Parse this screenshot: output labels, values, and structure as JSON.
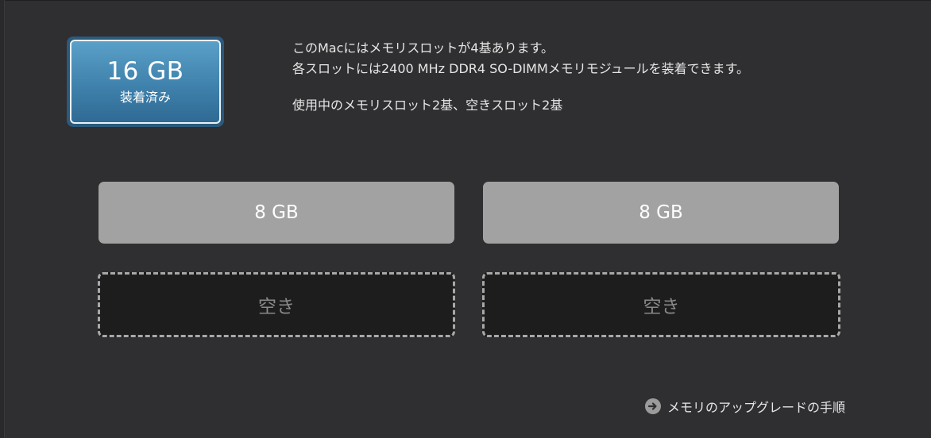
{
  "installed": {
    "size": "16 GB",
    "label": "装着済み"
  },
  "info": {
    "line1": "このMacにはメモリスロットが4基あります。",
    "line2": "各スロットには2400 MHz DDR4 SO-DIMMメモリモジュールを装着できます。",
    "line3": "使用中のメモリスロット2基、空きスロット2基"
  },
  "slots": [
    {
      "label": "8 GB",
      "state": "filled"
    },
    {
      "label": "8 GB",
      "state": "filled"
    },
    {
      "label": "空き",
      "state": "empty"
    },
    {
      "label": "空き",
      "state": "empty"
    }
  ],
  "upgrade_link": {
    "label": "メモリのアップグレードの手順",
    "icon": "arrow-right-circle-icon"
  },
  "colors": {
    "background": "#2f2e30",
    "installed_blue": "#4a8fbb",
    "slot_filled": "#a3a2a3",
    "slot_empty": "#1e1d1e"
  }
}
